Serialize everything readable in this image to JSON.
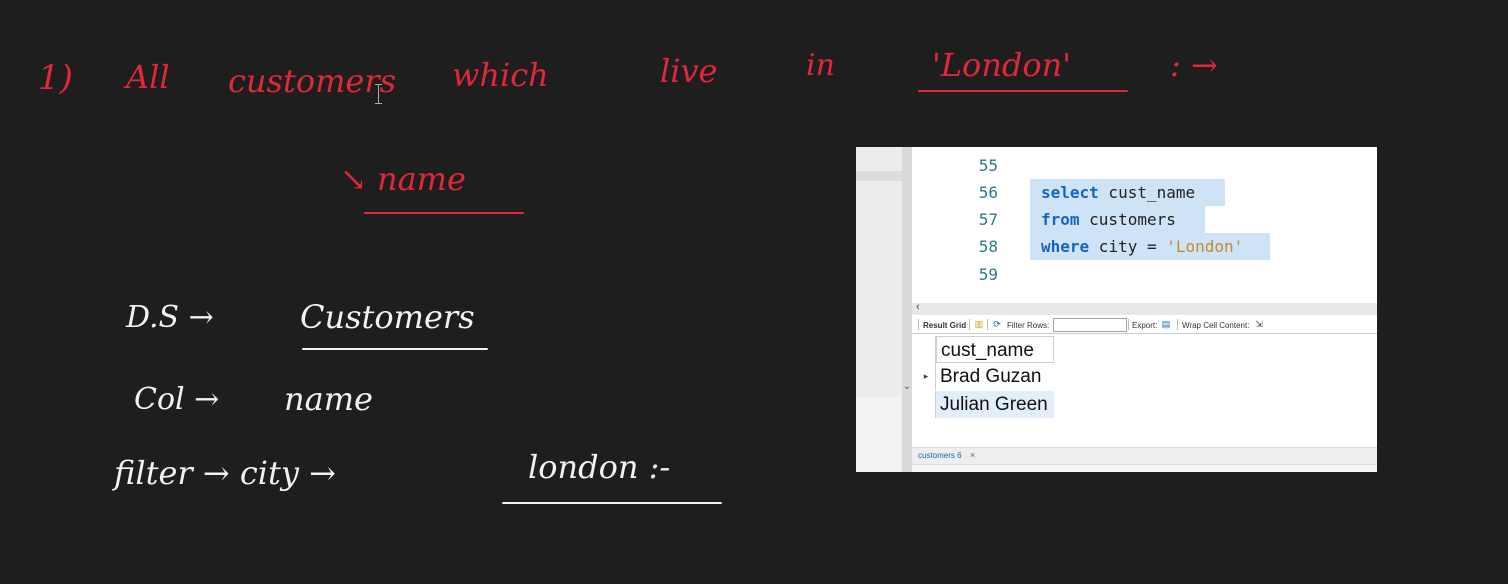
{
  "notes": {
    "line1": {
      "number": "1)",
      "words": [
        "All",
        "customers",
        "which",
        "live",
        "in",
        "'London'",
        ": →"
      ]
    },
    "line2": {
      "arrow_name": "↘ name"
    },
    "db": {
      "label": "D.S →",
      "value": "Customers"
    },
    "col": {
      "label": "Col →",
      "value": "name"
    },
    "filter": {
      "label": "filter → city →",
      "value": "london :-"
    }
  },
  "colors": {
    "red_ink": "#e0283a",
    "white_ink": "#f2f2f2",
    "board_bg": "#1e1e1e",
    "selection": "#cfe3f7"
  },
  "sql_editor": {
    "line_numbers": [
      "55",
      "56",
      "57",
      "58",
      "59"
    ],
    "lines": [
      {
        "keyword": "select",
        "text": " cust_name"
      },
      {
        "keyword": "from",
        "text": " customers"
      },
      {
        "keyword": "where",
        "text": " city = ",
        "string": "'London'"
      }
    ]
  },
  "result_toolbar": {
    "result_grid": "Result Grid",
    "filter_rows": "Filter Rows:",
    "export": "Export:",
    "wrap_cell_content": "Wrap Cell Content:"
  },
  "result_grid": {
    "columns": [
      "cust_name"
    ],
    "rows": [
      [
        "Brad Guzan"
      ],
      [
        "Julian Green"
      ]
    ]
  },
  "tabs": [
    {
      "label": "customers 6",
      "close": "×"
    }
  ],
  "icons": [
    "text-cursor-icon",
    "grid-icon",
    "refresh-icon",
    "export-icon",
    "wrap-icon",
    "row-pointer-icon",
    "hand-cursor-icon"
  ]
}
